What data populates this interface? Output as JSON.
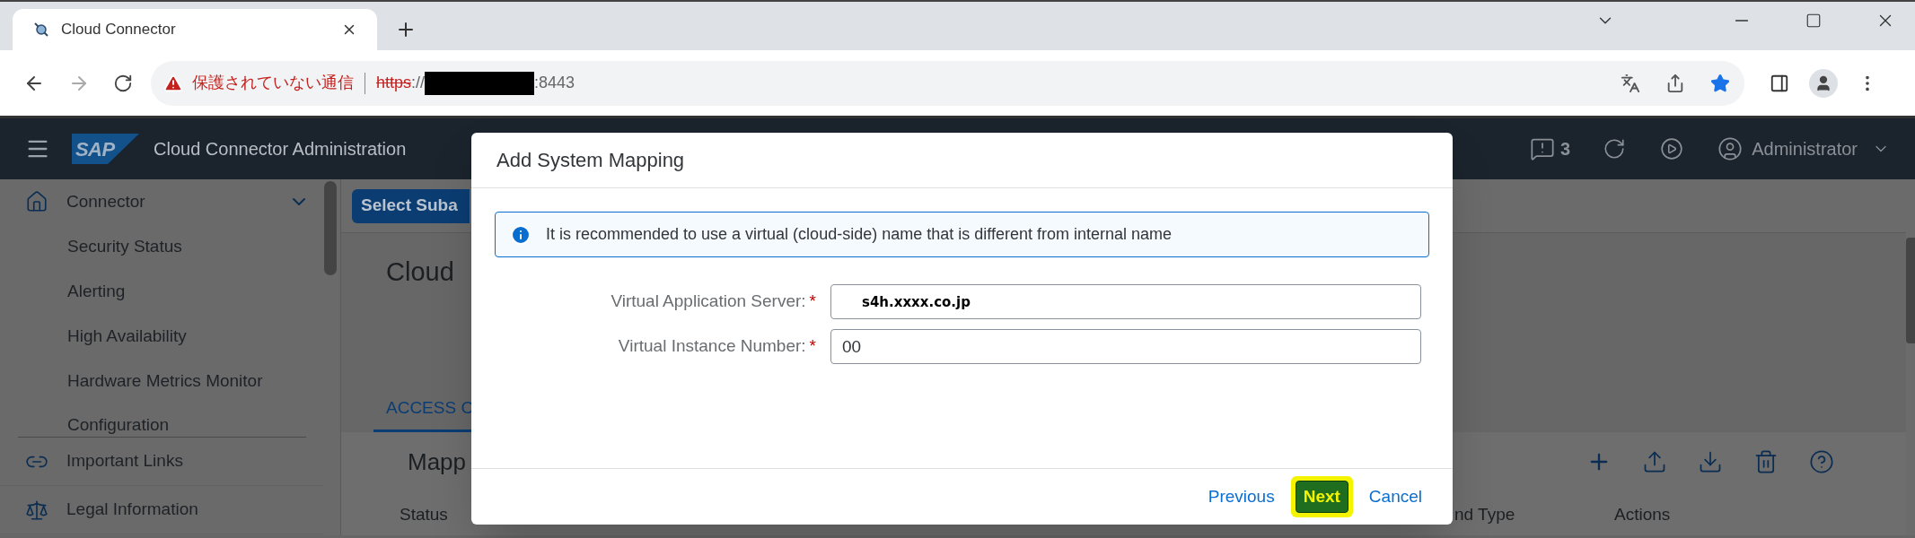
{
  "browser": {
    "tab": {
      "title": "Cloud Connector"
    },
    "address": {
      "security_warning": "保護されていない通信",
      "scheme": "https",
      "separator": "://",
      "port": ":8443",
      "bookmarked": true
    }
  },
  "app": {
    "logo": "SAP",
    "title": "Cloud Connector Administration",
    "notifications": "3",
    "user": "Administrator"
  },
  "sidebar": {
    "items": [
      {
        "label": "Connector",
        "expanded": true,
        "children": [
          {
            "label": "Security Status"
          },
          {
            "label": "Alerting"
          },
          {
            "label": "High Availability"
          },
          {
            "label": "Hardware Metrics Monitor"
          },
          {
            "label": "Configuration"
          }
        ]
      },
      {
        "label": "Important Links"
      },
      {
        "label": "Legal Information"
      }
    ]
  },
  "content": {
    "subaccount_button": "Select Suba",
    "title": "Cloud",
    "tab": {
      "label": "ACCESS C",
      "selected": true
    },
    "section_title": "Mapp",
    "columns": [
      "Status",
      "nd Type",
      "Actions"
    ]
  },
  "dialog": {
    "title": "Add System Mapping",
    "info": "It is recommended to use a virtual (cloud-side) name that is different from internal name",
    "fields": [
      {
        "label": "Virtual Application Server:",
        "required": true,
        "required_mark": "*",
        "value": "s4h.xxxx.co.jp"
      },
      {
        "label": "Virtual Instance Number:",
        "required": true,
        "required_mark": "*",
        "value": "00"
      }
    ],
    "buttons": [
      {
        "label": "Previous",
        "kind": "link",
        "highlighted": false
      },
      {
        "label": "Next",
        "kind": "primary",
        "highlighted": true
      },
      {
        "label": "Cancel",
        "kind": "link",
        "highlighted": false
      }
    ]
  }
}
